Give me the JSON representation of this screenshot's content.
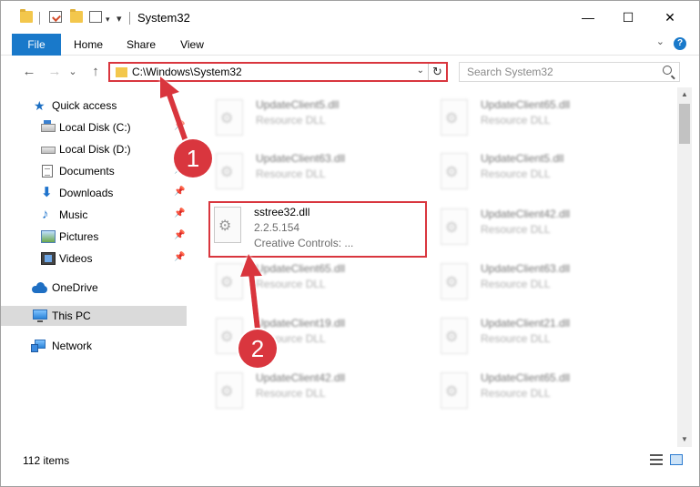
{
  "window": {
    "title": "System32",
    "minimize": "—",
    "maximize": "☐",
    "close": "✕"
  },
  "ribbon": {
    "tabs": [
      {
        "label": "File"
      },
      {
        "label": "Home"
      },
      {
        "label": "Share"
      },
      {
        "label": "View"
      }
    ],
    "help": "?"
  },
  "nav": {
    "back": "←",
    "forward": "→",
    "recent": "⌄",
    "up": "↑"
  },
  "address": {
    "path": "C:\\Windows\\System32",
    "refresh": "↻"
  },
  "search": {
    "placeholder": "Search System32"
  },
  "sidebar": {
    "items": [
      {
        "label": "Quick access",
        "icon": "quick-access-star-icon"
      },
      {
        "label": "Local Disk (C:)",
        "icon": "local-disk-c-icon"
      },
      {
        "label": "Local Disk (D:)",
        "icon": "local-disk-d-icon"
      },
      {
        "label": "Documents",
        "icon": "documents-icon"
      },
      {
        "label": "Downloads",
        "icon": "downloads-icon"
      },
      {
        "label": "Music",
        "icon": "music-icon"
      },
      {
        "label": "Pictures",
        "icon": "pictures-icon"
      },
      {
        "label": "Videos",
        "icon": "videos-icon"
      },
      {
        "label": "OneDrive",
        "icon": "onedrive-icon"
      },
      {
        "label": "This PC",
        "icon": "this-pc-icon"
      },
      {
        "label": "Network",
        "icon": "network-icon"
      }
    ]
  },
  "files": {
    "left": [
      {
        "name": "UpdateClient5.dll",
        "desc": "Resource DLL"
      },
      {
        "name": "UpdateClient63.dll",
        "desc": "Resource DLL"
      },
      {
        "name": "sstree32.dll",
        "desc": "2.2.5.154",
        "extra": "Creative Controls: ..."
      },
      {
        "name": "UpdateClient65.dll",
        "desc": "Resource DLL"
      },
      {
        "name": "UpdateClient19.dll",
        "desc": "Resource DLL"
      },
      {
        "name": "UpdateClient42.dll",
        "desc": "Resource DLL"
      }
    ],
    "right": [
      {
        "name": "UpdateClient65.dll",
        "desc": "Resource DLL"
      },
      {
        "name": "UpdateClient5.dll",
        "desc": "Resource DLL"
      },
      {
        "name": "UpdateClient42.dll",
        "desc": "Resource DLL"
      },
      {
        "name": "UpdateClient63.dll",
        "desc": "Resource DLL"
      },
      {
        "name": "UpdateClient21.dll",
        "desc": "Resource DLL"
      },
      {
        "name": "UpdateClient65.dll",
        "desc": "Resource DLL"
      }
    ]
  },
  "status": {
    "item_count": "112 items"
  },
  "annotations": {
    "badge1": "1",
    "badge2": "2",
    "accent": "#d9363e"
  },
  "colors": {
    "file_tab": "#1979ca",
    "highlight": "#d9363e",
    "selected_nav": "#dadada"
  }
}
